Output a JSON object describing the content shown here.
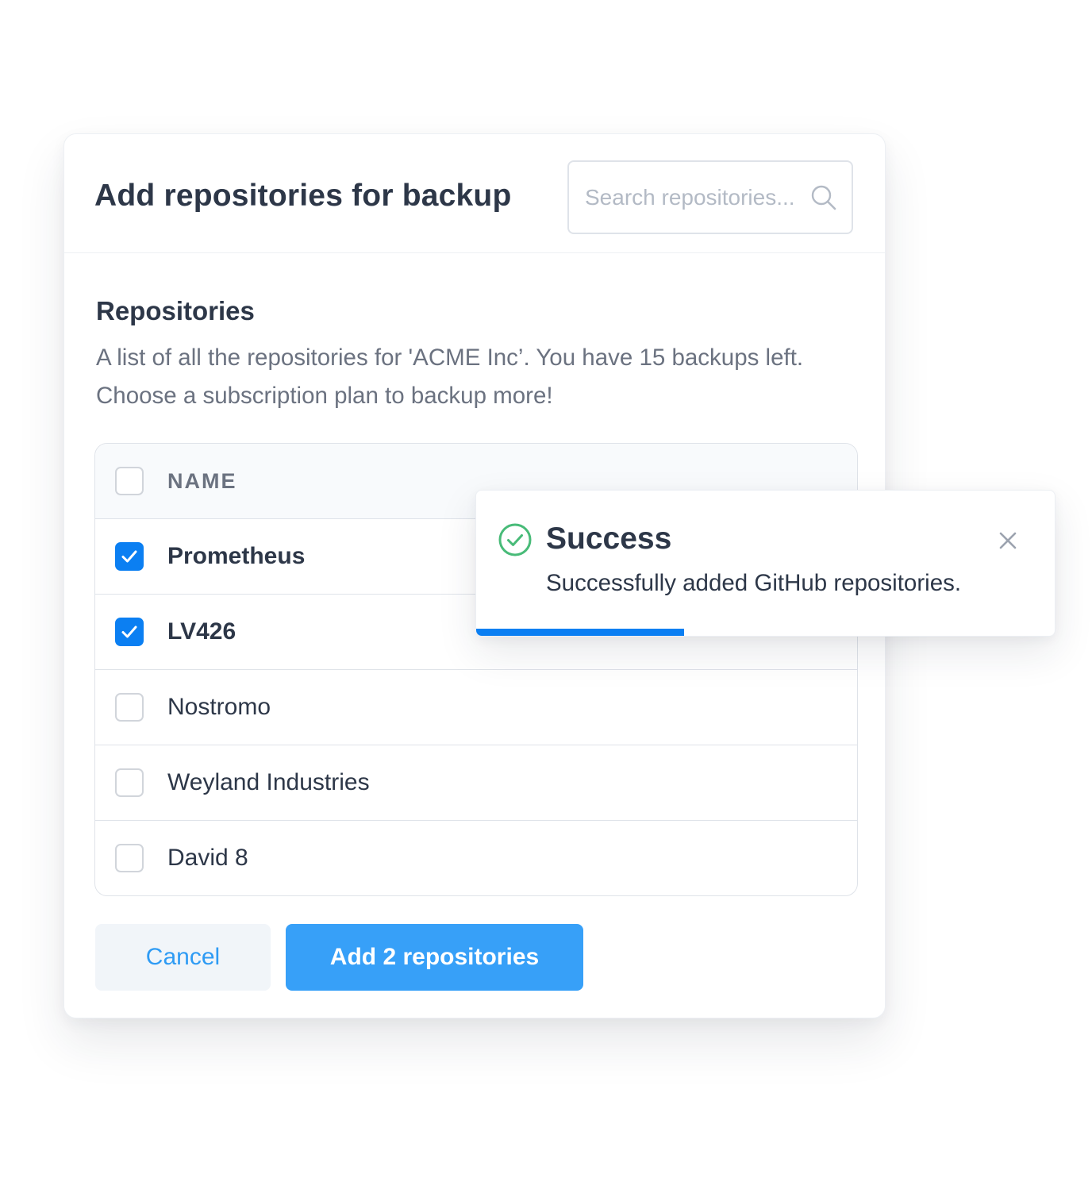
{
  "dialog": {
    "title": "Add repositories for backup",
    "search": {
      "placeholder": "Search repositories...",
      "value": "",
      "icon": "search-icon"
    }
  },
  "section": {
    "title": "Repositories",
    "description": "A list of all the repositories for 'ACME Inc’. You have 15 backups left. Choose a subscription plan to backup more!"
  },
  "table": {
    "header": {
      "label": "NAME",
      "select_all_checked": false
    },
    "rows": [
      {
        "name": "Prometheus",
        "checked": true
      },
      {
        "name": "LV426",
        "checked": true
      },
      {
        "name": "Nostromo",
        "checked": false
      },
      {
        "name": "Weyland Industries",
        "checked": false
      },
      {
        "name": "David 8",
        "checked": false
      }
    ]
  },
  "buttons": {
    "cancel": "Cancel",
    "add": "Add 2 repositories"
  },
  "toast": {
    "title": "Success",
    "message": "Successfully added GitHub repositories.",
    "icon": "check-circle-icon",
    "close_icon": "close-icon",
    "progress": 0.36
  },
  "colors": {
    "accent": "#0b7ff2",
    "primary_button": "#37a0f8",
    "success": "#48bb78",
    "text": "#2d3748",
    "muted_text": "#6b7280"
  }
}
